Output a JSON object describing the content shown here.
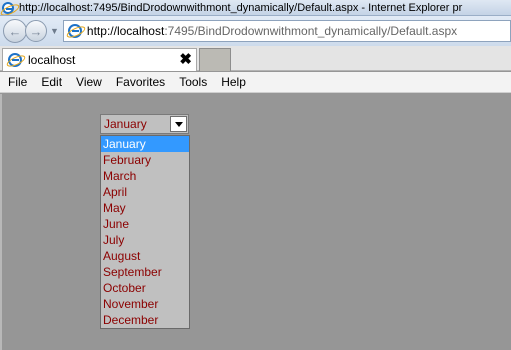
{
  "window": {
    "title": "http://localhost:7495/BindDrodownwithmont_dynamically/Default.aspx - Internet Explorer pr"
  },
  "address_bar": {
    "url_host": "http://localhost",
    "url_rest": ":7495/BindDrodownwithmont_dynamically/Default.aspx"
  },
  "tab": {
    "title": "localhost",
    "close_label": "✖"
  },
  "menu": [
    "File",
    "Edit",
    "View",
    "Favorites",
    "Tools",
    "Help"
  ],
  "month_select": {
    "selected": "January",
    "options": [
      "January",
      "February",
      "March",
      "April",
      "May",
      "June",
      "July",
      "August",
      "September",
      "October",
      "November",
      "December"
    ],
    "highlighted": "January"
  },
  "colors": {
    "option_text": "#8b0000",
    "highlight": "#3399ff",
    "page_background": "#969696"
  }
}
